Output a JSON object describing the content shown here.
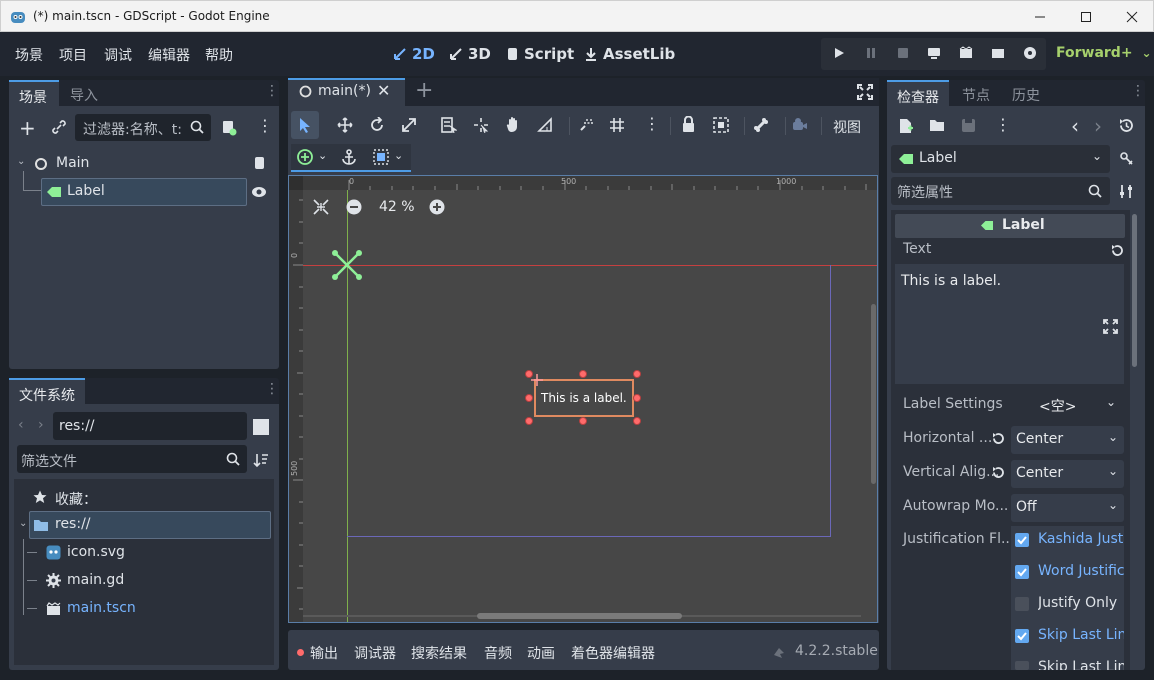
{
  "window": {
    "title": "(*) main.tscn - GDScript - Godot Engine"
  },
  "menu": [
    "场景",
    "项目",
    "调试",
    "编辑器",
    "帮助"
  ],
  "workspaces": [
    {
      "label": "2D",
      "icon": "2d-icon",
      "active": true
    },
    {
      "label": "3D",
      "icon": "3d-icon",
      "active": false
    },
    {
      "label": "Script",
      "icon": "script-icon",
      "active": false
    },
    {
      "label": "AssetLib",
      "icon": "assetlib-icon",
      "active": false
    }
  ],
  "renderer": "Forward+",
  "scene_dock": {
    "tabs": [
      "场景",
      "导入"
    ],
    "filter_placeholder": "过滤器:名称、t:",
    "tree": [
      {
        "name": "Main",
        "icon": "node2d-icon"
      },
      {
        "name": "Label",
        "icon": "label-icon"
      }
    ]
  },
  "filesystem_dock": {
    "tab": "文件系统",
    "path": "res://",
    "filter_placeholder": "筛选文件",
    "favorites_label": "收藏：",
    "root": "res://",
    "files": [
      {
        "name": "icon.svg",
        "icon": "svg-file-icon",
        "highlight": false
      },
      {
        "name": "main.gd",
        "icon": "gear-icon",
        "highlight": false
      },
      {
        "name": "main.tscn",
        "icon": "scene-file-icon",
        "highlight": true
      }
    ]
  },
  "editor": {
    "scene_tab": "main(*)",
    "view_label": "视图",
    "zoom": "42 %",
    "ruler_ticks": [
      "0",
      "500",
      "1000"
    ],
    "vruler_ticks": [
      "0",
      "500"
    ],
    "label_text": "This is a label."
  },
  "bottom_panel": {
    "tabs": [
      "输出",
      "调试器",
      "搜索结果",
      "音频",
      "动画",
      "着色器编辑器"
    ],
    "version": "4.2.2.stable"
  },
  "inspector": {
    "tabs": [
      "检查器",
      "节点",
      "历史"
    ],
    "node": "Label",
    "filter_placeholder": "筛选属性",
    "section_title": "Label",
    "text_label": "Text",
    "text_value": "This is a label.",
    "properties": [
      {
        "label": "Label Settings",
        "value": "<空>"
      },
      {
        "label": "Horizontal ...",
        "value": "Center"
      },
      {
        "label": "Vertical Alig...",
        "value": "Center"
      },
      {
        "label": "Autowrap Mo...",
        "value": "Off"
      },
      {
        "label": "Justification Fl...",
        "value": ""
      }
    ],
    "flags": [
      {
        "label": "Kashida Just",
        "checked": true
      },
      {
        "label": "Word Justific",
        "checked": true
      },
      {
        "label": "Justify Only",
        "checked": false
      },
      {
        "label": "Skip Last Lin",
        "checked": true
      },
      {
        "label": "Skip Last Lin",
        "checked": false
      }
    ]
  },
  "colors": {
    "accent": "#4d9ce6",
    "selected_label": "#ff6b6b",
    "label_icon": "#8eef97"
  }
}
